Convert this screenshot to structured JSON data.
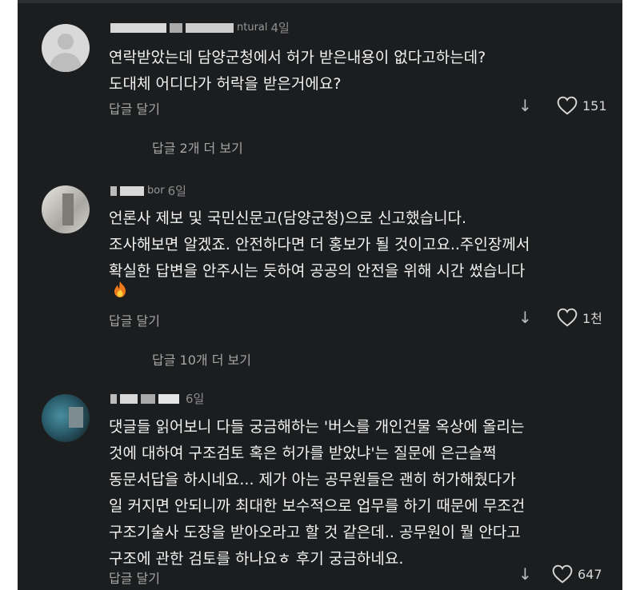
{
  "comments": [
    {
      "time": "4일",
      "name_visible": "ntural",
      "text": "연락받았는데 담양군청에서 허가 받은내용이 없다고하는데?\n도대체 어디다가 허락을 받은거에요?",
      "reply_label": "답글 달기",
      "likes": "151",
      "more_replies": "답글 2개 더 보기"
    },
    {
      "time": "6일",
      "name_visible": "bor",
      "text": "언론사 제보 및 국민신문고(담양군청)으로 신고했습니다.\n조사해보면 알겠죠. 안전하다면 더 홍보가 될 것이고요..주인장께서\n확실한 답변을 안주시는 듯하여 공공의 안전을 위해 시간 썼습니다",
      "emoji": "fire",
      "reply_label": "답글 달기",
      "likes": "1천",
      "more_replies": "답글 10개 더 보기"
    },
    {
      "time": "6일",
      "name_visible": "",
      "text": "댓글들 읽어보니 다들 궁금해하는 '버스를 개인건물 옥상에 올리는\n것에 대하여 구조검토 혹은 허가를 받았냐'는 질문에 은근슬쩍\n동문서답을 하시네요... 제가 아는 공무원들은 괜히 허가해줬다가\n일 커지면 안되니까 최대한 보수적으로 업무를 하기 때문에 무조건\n구조기술사 도장을 받아오라고 할 것 같은데.. 공무원이 뭘 안다고\n구조에 관한 검토를 하나요ㅎ 후기 궁금하네요.",
      "reply_label": "답글 달기",
      "likes": "647"
    }
  ],
  "colors": {
    "background": "#1b1d1f",
    "text": "#f2f2f2",
    "muted": "#a6a6a6"
  },
  "icons": {
    "downvote": "arrow-down-icon",
    "like": "heart-icon",
    "emoji": "fire-icon"
  }
}
